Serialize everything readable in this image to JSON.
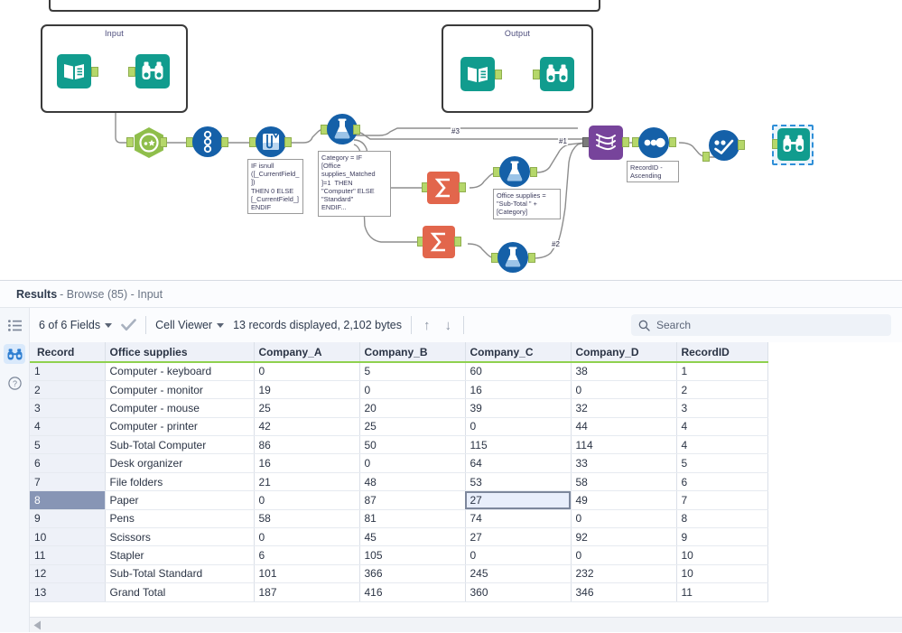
{
  "canvas": {
    "containers": [
      {
        "title": "Input"
      },
      {
        "title": "Output"
      }
    ],
    "annotations": [
      {
        "id": "multifield-formula",
        "text": "IF isnull\n([_CurrentField_])\nTHEN 0 ELSE\n[_CurrentField_]\nENDIF"
      },
      {
        "id": "formula-category",
        "text": "Category = IF\n[Office\nsupplies_Matched\n]=1  THEN\n\"Computer\" ELSE\n\"Standard\"\nENDIF..."
      },
      {
        "id": "formula-subtotal",
        "text": "Office supplies =\n\"Sub-Total \" +\n[Category]"
      },
      {
        "id": "sort-recordid",
        "text": "RecordID -\nAscending"
      }
    ],
    "wire_labels": [
      "#3",
      "#1",
      "#2"
    ],
    "tools": [
      {
        "id": "input-data-1",
        "name": "input-data-tool",
        "icon": "book-icon"
      },
      {
        "id": "browse-input",
        "name": "browse-tool",
        "icon": "binoculars-icon"
      },
      {
        "id": "input-data-2",
        "name": "input-data-tool",
        "icon": "book-icon"
      },
      {
        "id": "browse-output",
        "name": "browse-tool",
        "icon": "binoculars-icon"
      },
      {
        "id": "select-tool",
        "name": "select-tool",
        "icon": "select-icon"
      },
      {
        "id": "recordid-tool",
        "name": "record-id-tool",
        "icon": "record-id-icon"
      },
      {
        "id": "multifield-formula-tool",
        "name": "multi-field-formula-tool",
        "icon": "beaker-icon"
      },
      {
        "id": "formula-tool-1",
        "name": "formula-tool",
        "icon": "flask-icon"
      },
      {
        "id": "summarize-tool-1",
        "name": "summarize-tool",
        "icon": "sigma-icon"
      },
      {
        "id": "summarize-tool-2",
        "name": "summarize-tool",
        "icon": "sigma-icon"
      },
      {
        "id": "formula-tool-2",
        "name": "formula-tool",
        "icon": "flask-icon"
      },
      {
        "id": "formula-tool-3",
        "name": "formula-tool",
        "icon": "flask-icon"
      },
      {
        "id": "union-tool",
        "name": "union-tool",
        "icon": "helix-icon"
      },
      {
        "id": "sort-tool",
        "name": "sort-tool",
        "icon": "sort-icon"
      },
      {
        "id": "sample-tool",
        "name": "sample-tool",
        "icon": "checkline-icon"
      },
      {
        "id": "browse-final",
        "name": "browse-tool",
        "icon": "binoculars-icon",
        "selected": true
      }
    ],
    "colors": {
      "input_green": "#119c8e",
      "select_green": "#8fbe4b",
      "prep_blue": "#1560a8",
      "summarize_red": "#e2664c",
      "join_purple": "#77449b",
      "connector_nub": "#b5d76a",
      "selection_blue": "#2f8fd8"
    }
  },
  "results": {
    "title": "Results",
    "subtitle": "- Browse (85) - Input",
    "rail": [
      {
        "name": "list-view-icon",
        "label": "List view"
      },
      {
        "name": "browse-icon",
        "label": "Browse",
        "active": true
      },
      {
        "name": "help-icon",
        "label": "Help"
      }
    ],
    "toolbar": {
      "fields_label": "6 of 6 Fields",
      "check_icon": "checkmark-icon",
      "viewer_label": "Cell Viewer",
      "record_info": "13 records displayed, 2,102 bytes",
      "up_arrow": "↑",
      "down_arrow": "↓"
    },
    "search": {
      "placeholder": "Search",
      "value": "",
      "icon": "search-icon"
    },
    "table": {
      "columns": [
        "Record",
        "Office supplies",
        "Company_A",
        "Company_B",
        "Company_C",
        "Company_D",
        "RecordID"
      ],
      "selected_row_index": 7,
      "selected_cell": {
        "row": 7,
        "col": 4
      },
      "rows": [
        {
          "record": "1",
          "cells": [
            "Computer - keyboard",
            "0",
            "5",
            "60",
            "38",
            "1"
          ]
        },
        {
          "record": "2",
          "cells": [
            "Computer - monitor",
            "19",
            "0",
            "16",
            "0",
            "2"
          ]
        },
        {
          "record": "3",
          "cells": [
            "Computer - mouse",
            "25",
            "20",
            "39",
            "32",
            "3"
          ]
        },
        {
          "record": "4",
          "cells": [
            "Computer - printer",
            "42",
            "25",
            "0",
            "44",
            "4"
          ]
        },
        {
          "record": "5",
          "cells": [
            "Sub-Total Computer",
            "86",
            "50",
            "115",
            "114",
            "4"
          ]
        },
        {
          "record": "6",
          "cells": [
            "Desk organizer",
            "16",
            "0",
            "64",
            "33",
            "5"
          ]
        },
        {
          "record": "7",
          "cells": [
            "File folders",
            "21",
            "48",
            "53",
            "58",
            "6"
          ]
        },
        {
          "record": "8",
          "cells": [
            "Paper",
            "0",
            "87",
            "27",
            "49",
            "7"
          ]
        },
        {
          "record": "9",
          "cells": [
            "Pens",
            "58",
            "81",
            "74",
            "0",
            "8"
          ]
        },
        {
          "record": "10",
          "cells": [
            "Scissors",
            "0",
            "45",
            "27",
            "92",
            "9"
          ]
        },
        {
          "record": "11",
          "cells": [
            "Stapler",
            "6",
            "105",
            "0",
            "0",
            "10"
          ]
        },
        {
          "record": "12",
          "cells": [
            "Sub-Total Standard",
            "101",
            "366",
            "245",
            "232",
            "10"
          ]
        },
        {
          "record": "13",
          "cells": [
            "Grand Total",
            "187",
            "416",
            "360",
            "346",
            "11"
          ]
        }
      ]
    },
    "scrollbar": {
      "left_arrow_icon": "scroll-left-arrow-icon"
    }
  }
}
